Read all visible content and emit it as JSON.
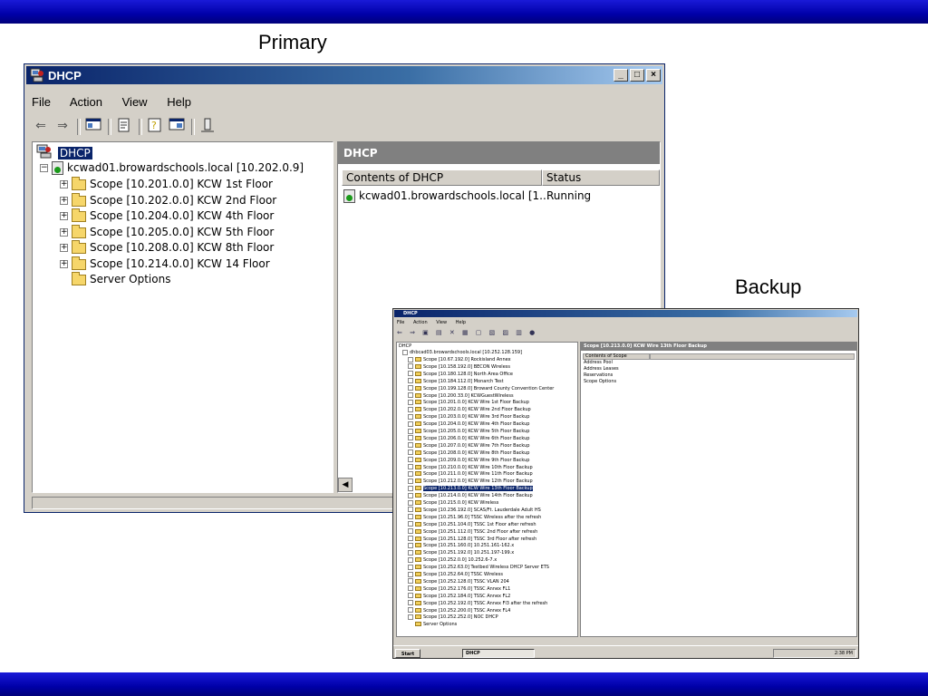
{
  "labels": {
    "primary": "Primary",
    "backup": "Backup"
  },
  "primary": {
    "title": "DHCP",
    "menu": [
      "File",
      "Action",
      "View",
      "Help"
    ],
    "tree": {
      "root": "DHCP",
      "server": "kcwad01.browardschools.local [10.202.0.9]",
      "scopes": [
        "Scope [10.201.0.0] KCW 1st Floor",
        "Scope [10.202.0.0] KCW 2nd Floor",
        "Scope [10.204.0.0] KCW 4th Floor",
        "Scope [10.205.0.0] KCW 5th Floor",
        "Scope [10.208.0.0] KCW 8th Floor",
        "Scope [10.214.0.0] KCW 14 Floor"
      ],
      "server_options": "Server Options"
    },
    "right": {
      "heading": "DHCP",
      "col_contents": "Contents of DHCP",
      "col_status": "Status",
      "row_name": "kcwad01.browardschools.local [1...",
      "row_status": "Running"
    }
  },
  "backup": {
    "title": "DHCP",
    "menu": [
      "File",
      "Action",
      "View",
      "Help"
    ],
    "root": "DHCP",
    "server": "dhbcad03.browardschools.local [10.252.128.159]",
    "scopes": [
      "Scope [10.67.192.0] Rockisland Annex",
      "Scope [10.158.192.0] BECON Wireless",
      "Scope [10.180.128.0] North Area Office",
      "Scope [10.184.112.0] Monarch Test",
      "Scope [10.199.128.0] Broward County Convention Center",
      "Scope [10.200.33.0] KCWGuestWireless",
      "Scope [10.201.0.0] KCW Wire 1st Floor Backup",
      "Scope [10.202.0.0] KCW Wire 2nd Floor Backup",
      "Scope [10.203.0.0] KCW Wire 3rd Floor Backup",
      "Scope [10.204.0.0] KCW Wire 4th Floor Backup",
      "Scope [10.205.0.0] KCW Wire 5th Floor Backup",
      "Scope [10.206.0.0] KCW Wire 6th Floor Backup",
      "Scope [10.207.0.0] KCW Wire 7th Floor Backup",
      "Scope [10.208.0.0] KCW Wire 8th Floor Backup",
      "Scope [10.209.0.0] KCW Wire 9th Floor Backup",
      "Scope [10.210.0.0] KCW Wire 10th Floor Backup",
      "Scope [10.211.0.0] KCW Wire 11th Floor Backup",
      "Scope [10.212.0.0] KCW Wire 12th Floor Backup",
      "Scope [10.213.0.0] KCW Wire 13th Floor Backup",
      "Scope [10.214.0.0] KCW Wire 14th Floor Backup",
      "Scope [10.215.0.0] KCW Wireless",
      "Scope [10.236.192.0] SCAS/Ft. Lauderdale Adult HS",
      "Scope [10.251.96.0] TSSC Wireless after the refresh",
      "Scope [10.251.104.0] TSSC 1st Floor after refresh",
      "Scope [10.251.112.0] TSSC 2nd Floor after refresh",
      "Scope [10.251.128.0] TSSC 3rd Floor after refresh",
      "Scope [10.251.160.0] 10.251.161-162.x",
      "Scope [10.251.192.0] 10.251.197-199.x",
      "Scope [10.252.0.0] 10.252.6-7.x",
      "Scope [10.252.63.0] Testbed Wireless DHCP Server ETS",
      "Scope [10.252.64.0] TSSC Wireless",
      "Scope [10.252.128.0] TSSC VLAN 204",
      "Scope [10.252.176.0] TSSC Annex FL1",
      "Scope [10.252.184.0] TSSC Annex FL2",
      "Scope [10.252.192.0] TSSC Annex Fl3 after the refresh",
      "Scope [10.252.200.0] TSSC Annex FL4",
      "Scope [10.252.252.0] NOC DHCP"
    ],
    "selected_index": 18,
    "server_options": "Server Options",
    "right_heading": "Scope [10.213.0.0] KCW Wire 13th Floor Backup",
    "right_col": "Contents of Scope",
    "right_items": [
      "Address Pool",
      "Address Leases",
      "Reservations",
      "Scope Options"
    ],
    "taskbar": {
      "start": "Start",
      "task": "DHCP",
      "clock": "2:38 PM"
    }
  }
}
